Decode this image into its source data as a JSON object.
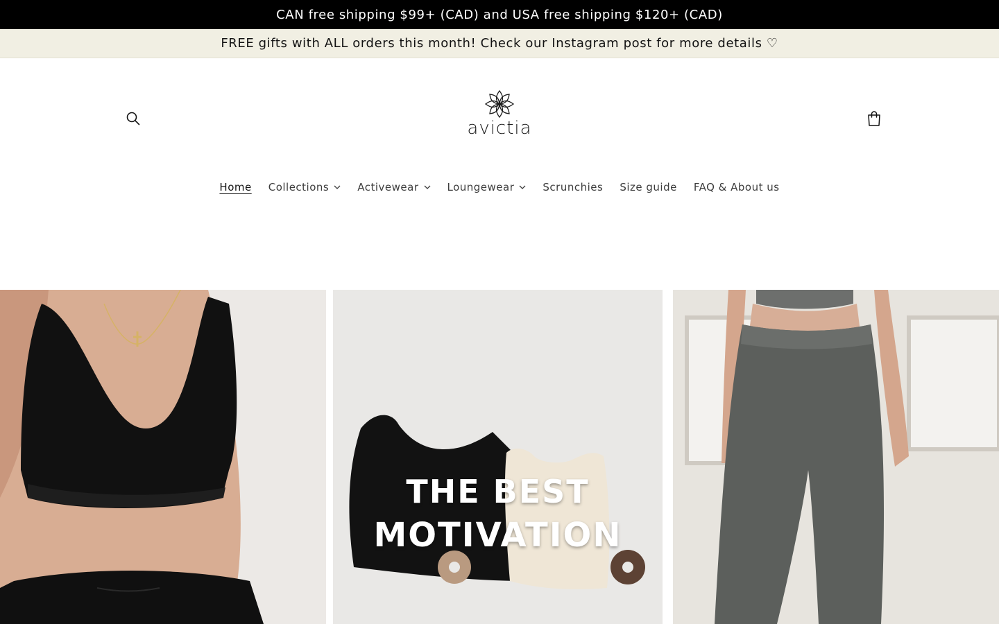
{
  "announcements": {
    "primary": "CAN free shipping $99+ (CAD) and USA free shipping $120+ (CAD)",
    "secondary": "FREE gifts with ALL orders this month! Check our Instagram post for more details ♡"
  },
  "header": {
    "logo_text": "avictia",
    "search_icon": "search-icon",
    "cart_icon": "bag-icon"
  },
  "nav": {
    "items": [
      {
        "label": "Home",
        "active": true
      },
      {
        "label": "Collections",
        "dropdown": true
      },
      {
        "label": "Activewear",
        "dropdown": true
      },
      {
        "label": "Loungewear",
        "dropdown": true
      },
      {
        "label": "Scrunchies"
      },
      {
        "label": "Size guide"
      },
      {
        "label": "FAQ & About us"
      }
    ]
  },
  "gallery": {
    "promo_line1": "THE BEST",
    "promo_line2": "MOTIVATION"
  },
  "colors": {
    "announcement_bg": "#000000",
    "secondary_bar_bg": "#f1efe3",
    "text": "#121212"
  }
}
